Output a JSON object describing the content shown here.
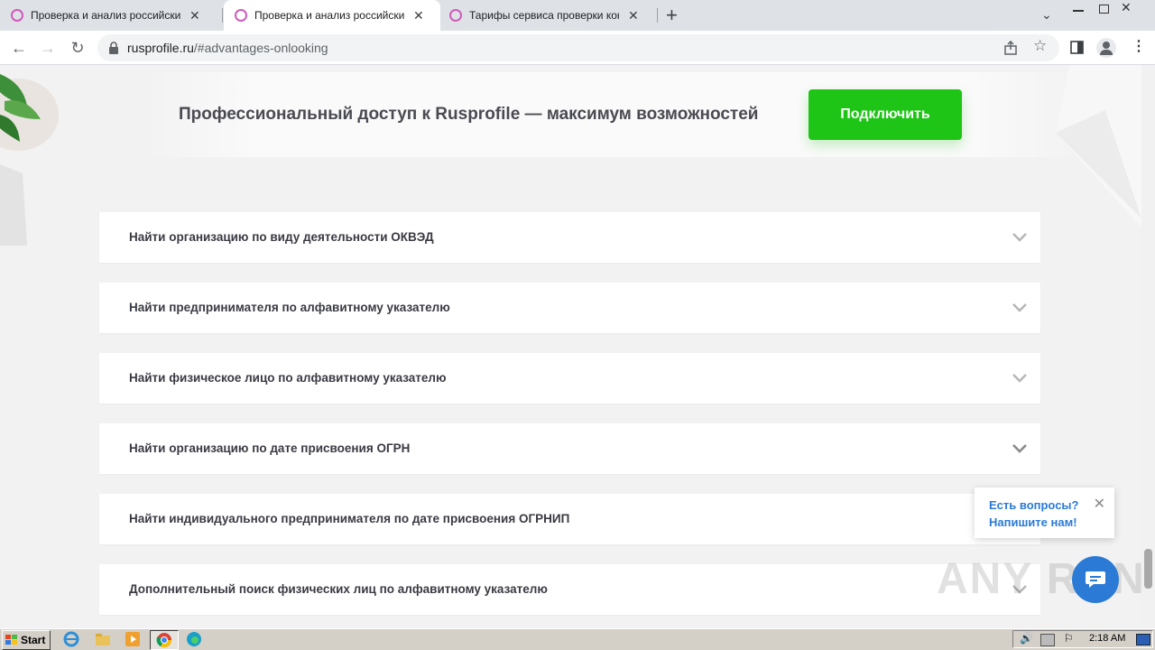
{
  "browser": {
    "tabs": [
      {
        "title": "Проверка и анализ российских юр",
        "active": false
      },
      {
        "title": "Проверка и анализ российских юр",
        "active": true
      },
      {
        "title": "Тарифы сервиса проверки контра",
        "active": false
      }
    ],
    "new_tab": "+",
    "url_host": "rusprofile.ru",
    "url_path": "/#advantages-onlooking"
  },
  "promo": {
    "text": "Профессиональный доступ к Rusprofile — максимум возможностей",
    "button": "Подключить"
  },
  "accordion": [
    "Найти организацию по виду деятельности ОКВЭД",
    "Найти предпринимателя по алфавитному указателю",
    "Найти физическое лицо по алфавитному указателю",
    "Найти организацию по дате присвоения ОГРН",
    "Найти индивидуального предпринимателя по дате присвоения ОГРНИП",
    "Дополнительный поиск физических лиц по алфавитному указателю"
  ],
  "chat": {
    "line1": "Есть вопросы?",
    "line2": "Напишите нам!"
  },
  "watermark": "ANY RUN",
  "taskbar": {
    "start": "Start",
    "clock": "2:18 AM"
  },
  "colors": {
    "accent_green": "#1ec516",
    "chat_blue": "#2a7ad6"
  }
}
